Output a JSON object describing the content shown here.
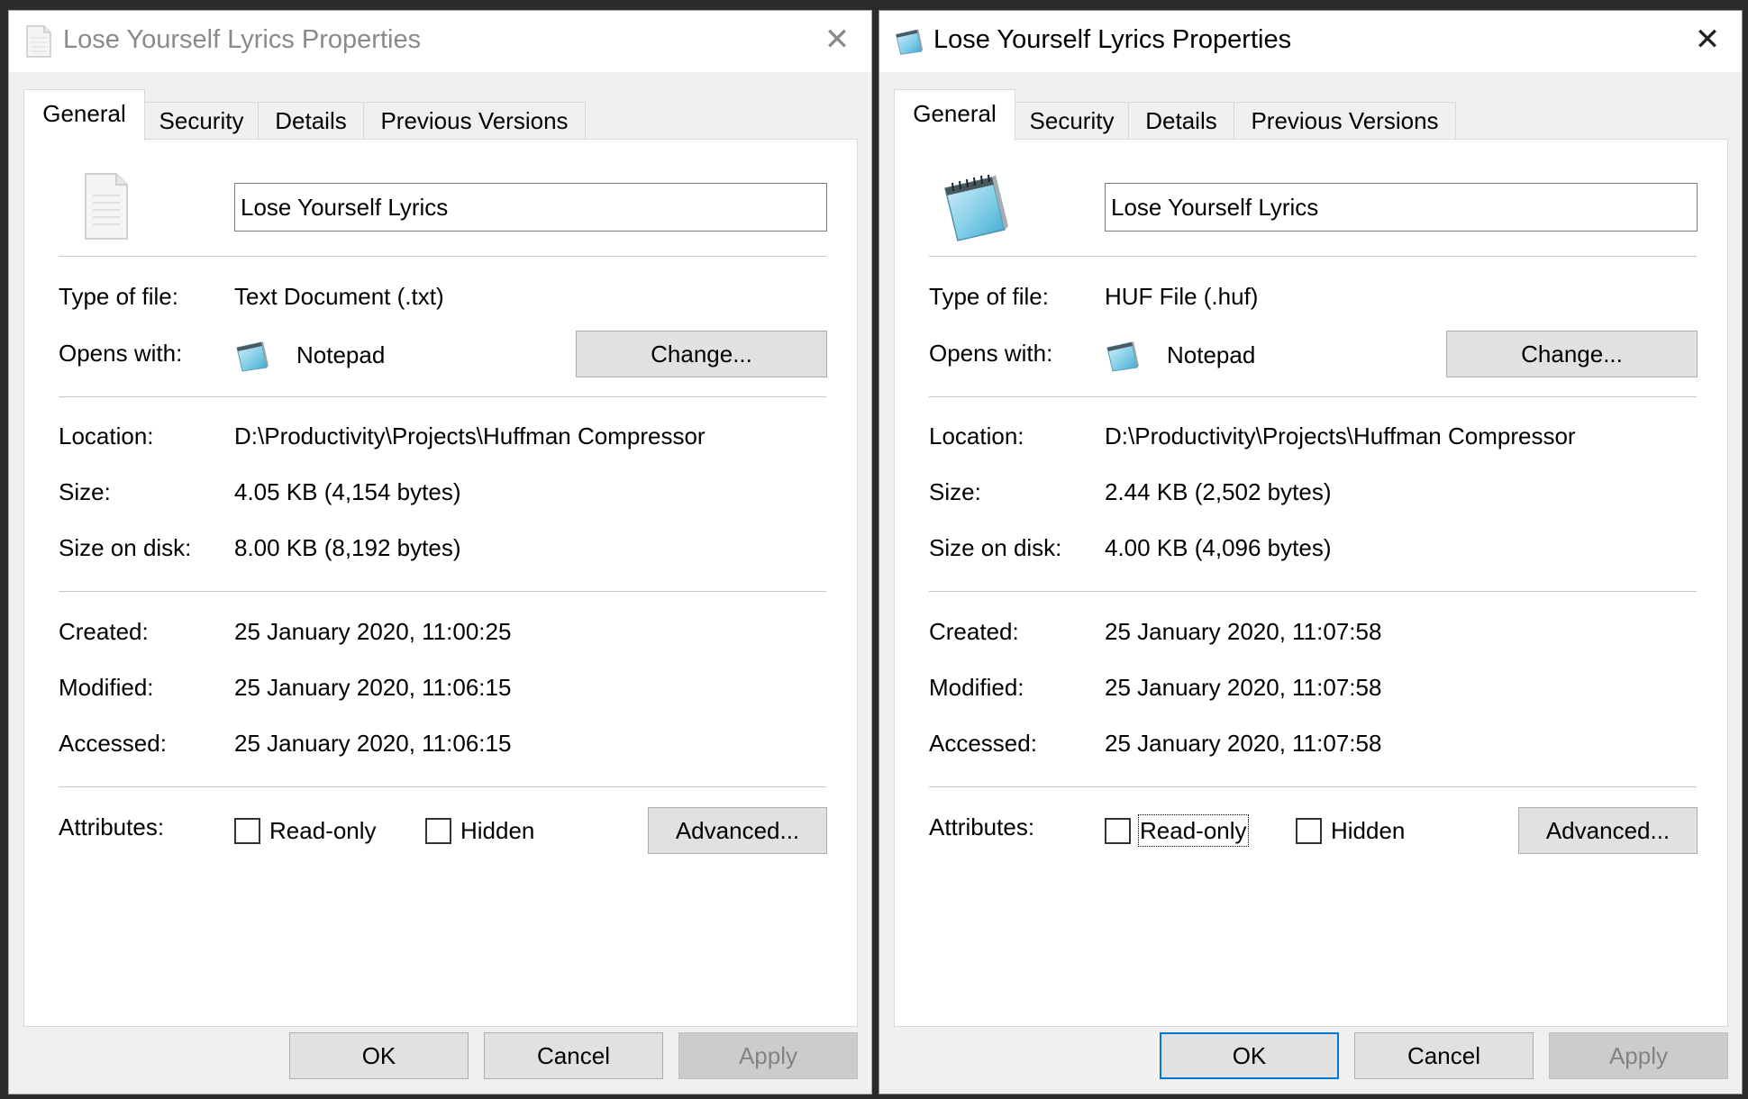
{
  "dialogs": {
    "left": {
      "title": "Lose Yourself Lyrics Properties",
      "close_glyph": "✕",
      "tabs": [
        {
          "label": "General"
        },
        {
          "label": "Security"
        },
        {
          "label": "Details"
        },
        {
          "label": "Previous Versions"
        }
      ],
      "file_name": "Lose Yourself Lyrics",
      "type_label": "Type of file:",
      "type_value": "Text Document (.txt)",
      "opens_label": "Opens with:",
      "opens_value": "Notepad",
      "change_label": "Change...",
      "location_label": "Location:",
      "location_value": "D:\\Productivity\\Projects\\Huffman Compressor",
      "size_label": "Size:",
      "size_value": "4.05 KB (4,154 bytes)",
      "disk_label": "Size on disk:",
      "disk_value": "8.00 KB (8,192 bytes)",
      "created_label": "Created:",
      "created_value": "25 January 2020, 11:00:25",
      "modified_label": "Modified:",
      "modified_value": "25 January 2020, 11:06:15",
      "accessed_label": "Accessed:",
      "accessed_value": "25 January 2020, 11:06:15",
      "attributes_label": "Attributes:",
      "readonly_label": "Read-only",
      "hidden_label": "Hidden",
      "advanced_label": "Advanced...",
      "ok_label": "OK",
      "cancel_label": "Cancel",
      "apply_label": "Apply",
      "file_icon": "text-document-icon"
    },
    "right": {
      "title": "Lose Yourself Lyrics Properties",
      "close_glyph": "✕",
      "tabs": [
        {
          "label": "General"
        },
        {
          "label": "Security"
        },
        {
          "label": "Details"
        },
        {
          "label": "Previous Versions"
        }
      ],
      "file_name": "Lose Yourself Lyrics",
      "type_label": "Type of file:",
      "type_value": "HUF File (.huf)",
      "opens_label": "Opens with:",
      "opens_value": "Notepad",
      "change_label": "Change...",
      "location_label": "Location:",
      "location_value": "D:\\Productivity\\Projects\\Huffman Compressor",
      "size_label": "Size:",
      "size_value": "2.44 KB (2,502 bytes)",
      "disk_label": "Size on disk:",
      "disk_value": "4.00 KB (4,096 bytes)",
      "created_label": "Created:",
      "created_value": "25 January 2020, 11:07:58",
      "modified_label": "Modified:",
      "modified_value": "25 January 2020, 11:07:58",
      "accessed_label": "Accessed:",
      "accessed_value": "25 January 2020, 11:07:58",
      "attributes_label": "Attributes:",
      "readonly_label": "Read-only",
      "hidden_label": "Hidden",
      "advanced_label": "Advanced...",
      "ok_label": "OK",
      "cancel_label": "Cancel",
      "apply_label": "Apply",
      "file_icon": "notepad-icon"
    }
  },
  "colors": {
    "accent": "#0078d7",
    "dialog_bg": "#f0f0f0",
    "panel_bg": "#ffffff",
    "button_bg": "#e1e1e1",
    "disabled_text": "#838383"
  }
}
